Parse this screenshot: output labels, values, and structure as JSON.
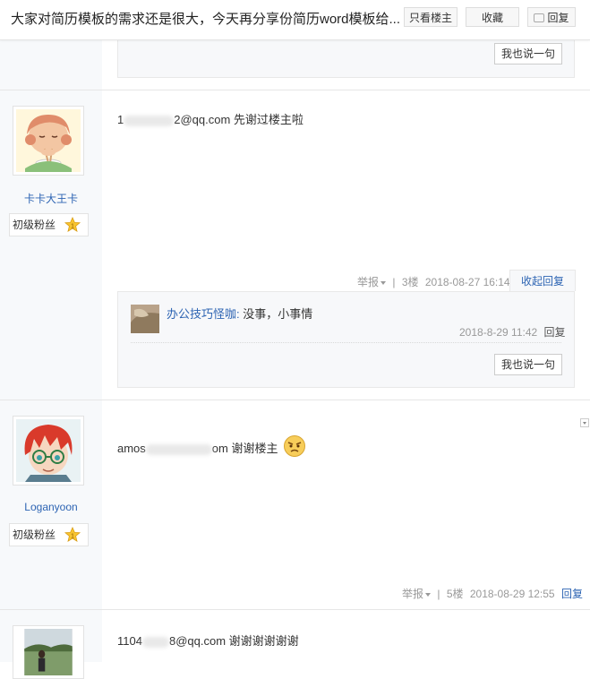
{
  "header": {
    "title": "大家对简历模板的需求还是很大，今天再分享份简历word模板给...",
    "only_author": "只看楼主",
    "collect": "收藏",
    "reply": "回复"
  },
  "say_button": "我也说一句",
  "posts": [
    {
      "username": "卡卡大王卡",
      "level": "初级粉丝",
      "content_prefix": "1",
      "content_suffix": "2@qq.com 先谢过楼主啦",
      "report": "举报",
      "floor": "3楼",
      "time": "2018-08-27 16:14",
      "collapse": "收起回复",
      "sub_reply": {
        "user": "办公技巧怪咖:",
        "text": "没事，小事情",
        "time": "2018-8-29 11:42",
        "reply": "回复"
      }
    },
    {
      "username": "Loganyoon",
      "level": "初级粉丝",
      "content_prefix": "amos",
      "content_suffix": "om 谢谢楼主",
      "report": "举报",
      "floor": "5楼",
      "time": "2018-08-29 12:55",
      "reply": "回复"
    },
    {
      "content_prefix": "1104",
      "content_suffix": "8@qq.com 谢谢谢谢谢谢"
    }
  ]
}
